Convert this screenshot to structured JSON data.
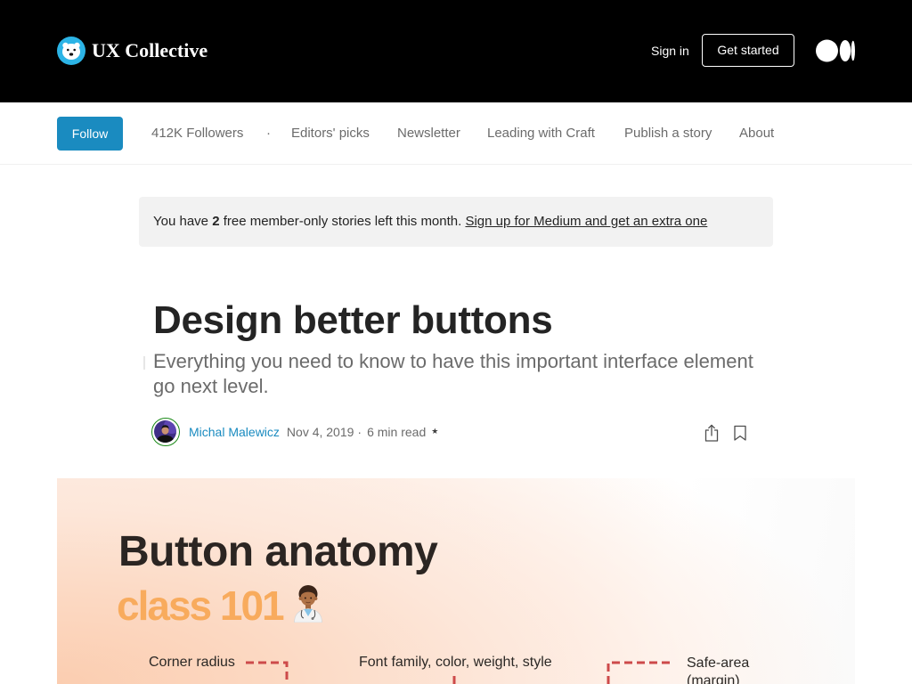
{
  "header": {
    "brand": "UX Collective",
    "sign_in": "Sign in",
    "get_started": "Get started"
  },
  "publication_nav": {
    "follow": "Follow",
    "followers": "412K Followers",
    "separator": "·",
    "links": [
      "Editors' picks",
      "Newsletter",
      "Leading with Craft",
      "Publish a story",
      "About"
    ]
  },
  "paywall_banner": {
    "prefix": "You have ",
    "count": "2",
    "middle": " free member-only stories left this month. ",
    "link": "Sign up for Medium and get an extra one"
  },
  "article": {
    "title": "Design better buttons",
    "subtitle": "Everything you need to know to have this important interface element go next level.",
    "author": "Michal Malewicz",
    "date": "Nov 4, 2019",
    "separator": "·",
    "read_time": "6 min read",
    "member_star": "★"
  },
  "hero_image": {
    "heading": "Button anatomy",
    "subheading": "class 101",
    "labels": {
      "corner_radius": "Corner radius",
      "font": "Font family, color, weight, style",
      "safe_area": "Safe-area (margin)"
    }
  },
  "icons": {
    "publication_logo": "ux-collective-bear-logo",
    "medium_logo": "medium-logo",
    "author_avatar": "author-avatar",
    "share": "share-icon",
    "bookmark": "bookmark-icon",
    "hero_emoji": "health-worker-emoji"
  },
  "colors": {
    "header_bg": "#000000",
    "accent_blue": "#1a8bc0",
    "member_ring": "#1a8917",
    "primary_text": "#242424",
    "muted_text": "#6b6b6b",
    "banner_bg": "#f2f2f2",
    "hero_orange": "#f8ab5d",
    "hero_guide_red": "#cd4a4a"
  }
}
